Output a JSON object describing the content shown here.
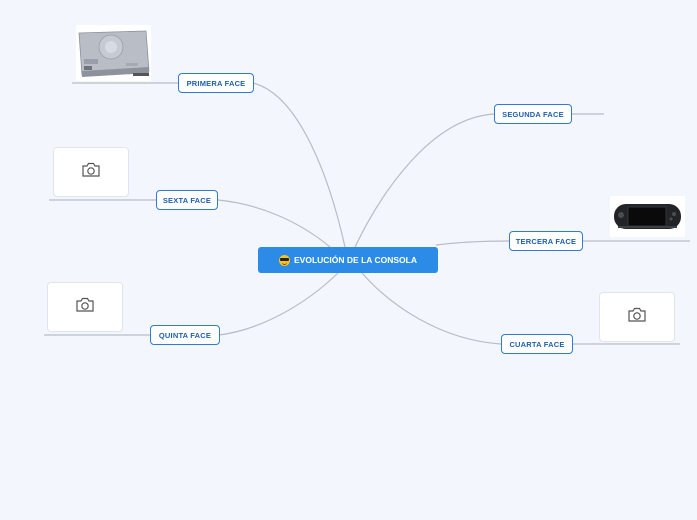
{
  "root": {
    "label": "EVOLUCIÓN DE LA CONSOLA",
    "icon": "sunglasses-emoji-icon"
  },
  "branches": {
    "primera": "PRIMERA FACE",
    "segunda": "SEGUNDA FACE",
    "tercera": "TERCERA FACE",
    "cuarta": "CUARTA FACE",
    "quinta": "QUINTA FACE",
    "sexta": "SEXTA FACE"
  },
  "images": {
    "primera": "playstation-console-photo",
    "tercera": "psp-handheld-photo",
    "sexta": "camera-icon",
    "quinta": "camera-icon",
    "cuarta": "camera-icon"
  },
  "colors": {
    "background": "#f4f6fd",
    "root": "#2b8be6",
    "node_border": "#2e7bd6",
    "node_text": "#1f5fae",
    "link": "#b8bcc6"
  }
}
